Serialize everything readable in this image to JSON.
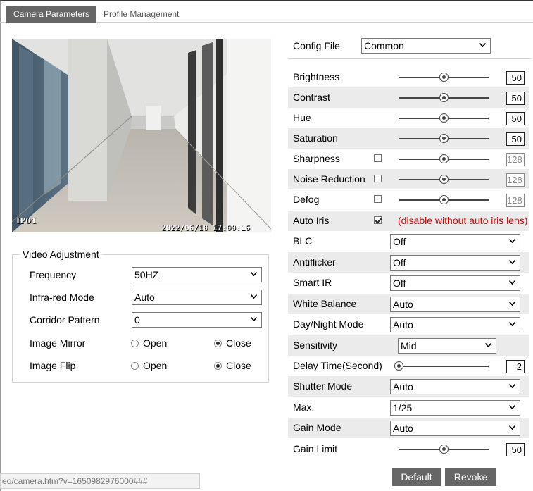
{
  "tabs": [
    {
      "label": "Camera Parameters",
      "active": true
    },
    {
      "label": "Profile Management",
      "active": false
    }
  ],
  "video": {
    "channel_label": "IP01",
    "timestamp": "2022/06/10  17:00:16"
  },
  "video_adjustment": {
    "legend": "Video Adjustment",
    "frequency": {
      "label": "Frequency",
      "value": "50HZ"
    },
    "infrared": {
      "label": "Infra-red Mode",
      "value": "Auto"
    },
    "corridor": {
      "label": "Corridor Pattern",
      "value": "0"
    },
    "mirror": {
      "label": "Image Mirror",
      "open": "Open",
      "close": "Close",
      "selected": "Close"
    },
    "flip": {
      "label": "Image Flip",
      "open": "Open",
      "close": "Close",
      "selected": "Close"
    }
  },
  "config_file": {
    "label": "Config File",
    "value": "Common"
  },
  "params": {
    "brightness": {
      "label": "Brightness",
      "value": "50",
      "slider_fraction": 0.5
    },
    "contrast": {
      "label": "Contrast",
      "value": "50",
      "slider_fraction": 0.5
    },
    "hue": {
      "label": "Hue",
      "value": "50",
      "slider_fraction": 0.5
    },
    "saturation": {
      "label": "Saturation",
      "value": "50",
      "slider_fraction": 0.5
    },
    "sharpness": {
      "label": "Sharpness",
      "value": "128",
      "checked": false,
      "slider_fraction": 0.5
    },
    "noise": {
      "label": "Noise Reduction",
      "value": "128",
      "checked": false,
      "slider_fraction": 0.5
    },
    "defog": {
      "label": "Defog",
      "value": "128",
      "checked": false,
      "slider_fraction": 0.5
    },
    "auto_iris": {
      "label": "Auto Iris",
      "checked": true,
      "note": "(disable without auto iris lens)"
    },
    "blc": {
      "label": "BLC",
      "value": "Off"
    },
    "antiflicker": {
      "label": "Antiflicker",
      "value": "Off"
    },
    "smart_ir": {
      "label": "Smart IR",
      "value": "Off"
    },
    "white_balance": {
      "label": "White Balance",
      "value": "Auto"
    },
    "day_night": {
      "label": "Day/Night Mode",
      "value": "Auto"
    },
    "sensitivity": {
      "label": "Sensitivity",
      "value": "Mid"
    },
    "delay_time": {
      "label": "Delay Time(Second)",
      "value": "2",
      "slider_fraction": 0.0
    },
    "shutter_mode": {
      "label": "Shutter Mode",
      "value": "Auto"
    },
    "max": {
      "label": "Max.",
      "value": "1/25"
    },
    "gain_mode": {
      "label": "Gain Mode",
      "value": "Auto"
    },
    "gain_limit": {
      "label": "Gain Limit",
      "value": "50",
      "slider_fraction": 0.5
    }
  },
  "buttons": {
    "default": "Default",
    "revoke": "Revoke"
  },
  "status_bar": {
    "text": "eo/camera.htm?v=1650982976000###"
  },
  "colors": {
    "tab_active": "#666666",
    "row_shade": "#ebebeb",
    "note": "#e00000",
    "button": "#666666"
  }
}
